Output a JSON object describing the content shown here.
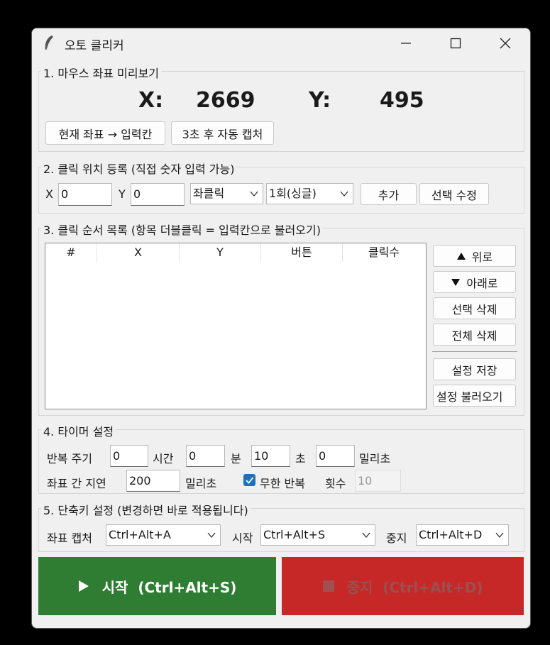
{
  "window": {
    "title": "오토 클리커"
  },
  "preview": {
    "group_title": "1. 마우스 좌표 미리보기",
    "x_label": "X:",
    "x_value": "2669",
    "y_label": "Y:",
    "y_value": "495",
    "to_input_button": "현재 좌표 → 입력칸",
    "auto_capture_button": "3초 후 자동 캡처"
  },
  "register": {
    "group_title": "2. 클릭 위치 등록  (직접 숫자 입력 가능)",
    "x_label": "X",
    "x_value": "0",
    "y_label": "Y",
    "y_value": "0",
    "button_select": "좌클릭",
    "count_select": "1회(싱글)",
    "add_button": "추가",
    "edit_button": "선택 수정"
  },
  "sequence": {
    "group_title": "3. 클릭 순서 목록  (항목 더블클릭 = 입력칸으로 불러오기)",
    "columns": [
      "#",
      "X",
      "Y",
      "버튼",
      "클릭수"
    ],
    "rows": [],
    "up_button": "위로",
    "down_button": "아래로",
    "delete_selected_button": "선택 삭제",
    "delete_all_button": "전체 삭제",
    "save_button": "설정 저장",
    "load_button": "설정 불러오기"
  },
  "timer": {
    "group_title": "4. 타이머 설정",
    "repeat_label": "반복 주기",
    "hours_value": "0",
    "hours_unit": "시간",
    "minutes_value": "0",
    "minutes_unit": "분",
    "seconds_value": "10",
    "seconds_unit": "초",
    "ms_value": "0",
    "ms_unit": "밀리초",
    "delay_label": "좌표 간 지연",
    "delay_value": "200",
    "delay_unit": "밀리초",
    "infinite_label": "무한 반복",
    "infinite_checked": true,
    "count_label": "횟수",
    "count_value": "10"
  },
  "hotkeys": {
    "group_title": "5. 단축키 설정  (변경하면 바로 적용됩니다)",
    "capture_label": "좌표 캡처",
    "capture_value": "Ctrl+Alt+A",
    "start_label": "시작",
    "start_value": "Ctrl+Alt+S",
    "stop_label": "중지",
    "stop_value": "Ctrl+Alt+D"
  },
  "actions": {
    "start_text": "시작  (Ctrl+Alt+S)",
    "stop_text": "중지  (Ctrl+Alt+D)",
    "start_color": "#2e7d32",
    "stop_color": "#c62828"
  }
}
